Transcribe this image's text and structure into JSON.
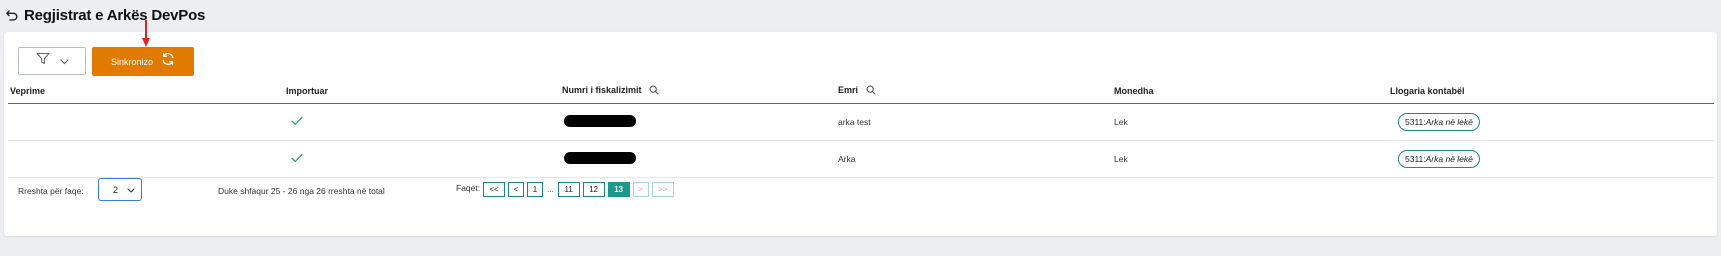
{
  "header": {
    "title": "Regjistrat e Arkës DevPos"
  },
  "toolbar": {
    "sync_label": "Sinkronizo"
  },
  "colors": {
    "accent": "#e07b00",
    "teal": "#1a8a7a",
    "active_page": "#1a9a8a",
    "arrow": "#e32222"
  },
  "table": {
    "columns": [
      "Veprime",
      "Importuar",
      "Numri i fiskalizimit",
      "Emri",
      "Monedha",
      "Llogaria kontabël"
    ],
    "rows": [
      {
        "imported": true,
        "fiscal_number": "",
        "name": "arka test",
        "currency": "Lek",
        "account_code": "5311:",
        "account_name": "Arka në lekë"
      },
      {
        "imported": true,
        "fiscal_number": "",
        "name": "Arka",
        "currency": "Lek",
        "account_code": "5311:",
        "account_name": "Arka në lekë"
      }
    ]
  },
  "footer": {
    "per_page_label": "Rreshta për faqe:",
    "per_page_value": "2",
    "showing_text": "Duke shfaqur 25 - 26 nga 26 rreshta në total",
    "pages_label": "Faqet:",
    "pager": {
      "first": "<<",
      "prev": "<",
      "p1": "1",
      "ellipsis": "...",
      "p11": "11",
      "p12": "12",
      "p13": "13",
      "next": ">",
      "last": ">>"
    }
  },
  "icons": {
    "back": "back-arrow-icon",
    "filter": "filter-icon",
    "chevron": "chevron-down-icon",
    "sync": "sync-icon",
    "search": "search-icon",
    "check": "check-icon"
  }
}
